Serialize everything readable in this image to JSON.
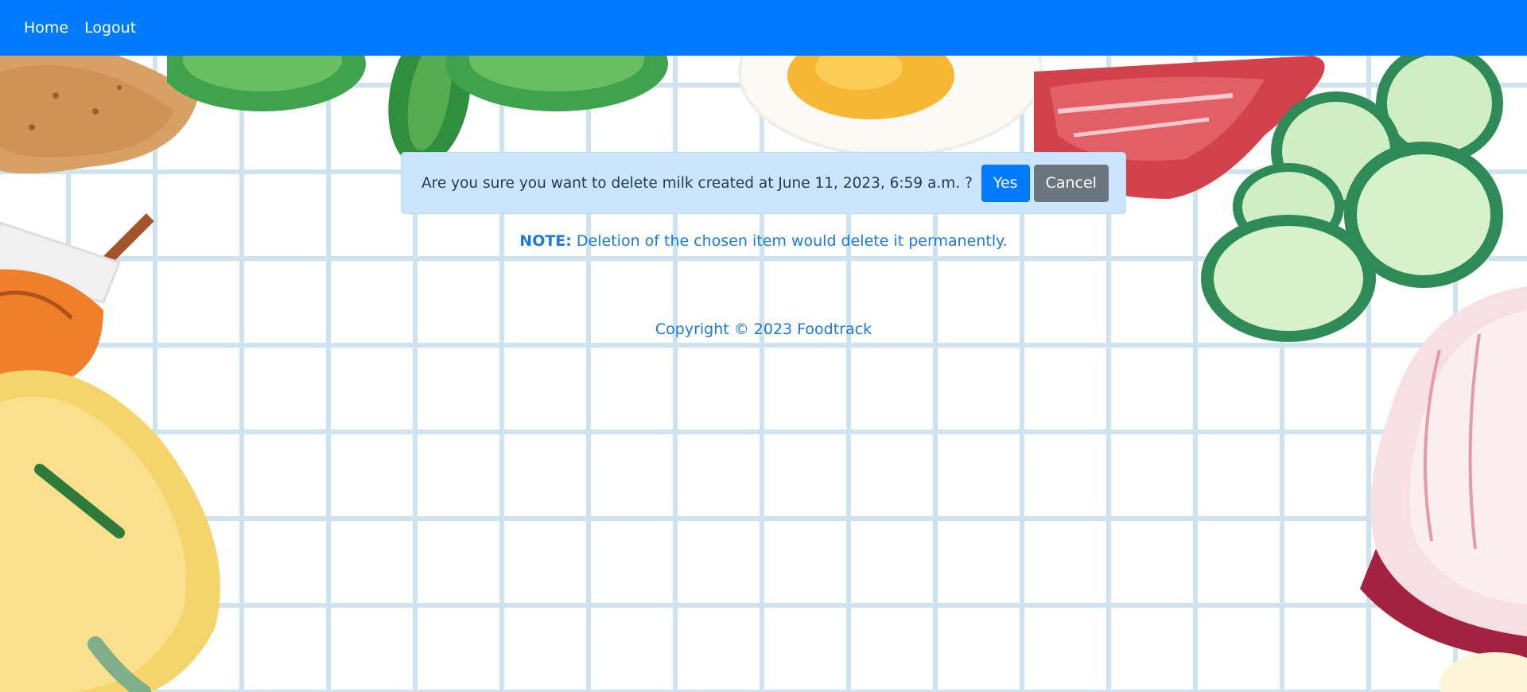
{
  "nav": {
    "home_label": "Home",
    "logout_label": "Logout"
  },
  "confirm": {
    "message": "Are you sure you want to delete milk created at June 11, 2023, 6:59 a.m. ?",
    "yes_label": "Yes",
    "cancel_label": "Cancel"
  },
  "note": {
    "label": "NOTE:",
    "text": " Deletion of the chosen item would delete it permanently."
  },
  "footer": {
    "copyright": "Copyright © 2023 Foodtrack"
  },
  "colors": {
    "navbar": "#007bff",
    "primary_button": "#007bff",
    "secondary_button": "#6c757d",
    "alert_background": "#cce5ff",
    "note_text": "#1a7ad8",
    "grid_lines": "#cfe2ef"
  },
  "decorations": [
    "bread-illustration",
    "basil-illustration",
    "egg-illustration",
    "meat-illustration",
    "cucumber-illustration",
    "honey-jar-illustration",
    "pasta-illustration",
    "onion-illustration"
  ]
}
